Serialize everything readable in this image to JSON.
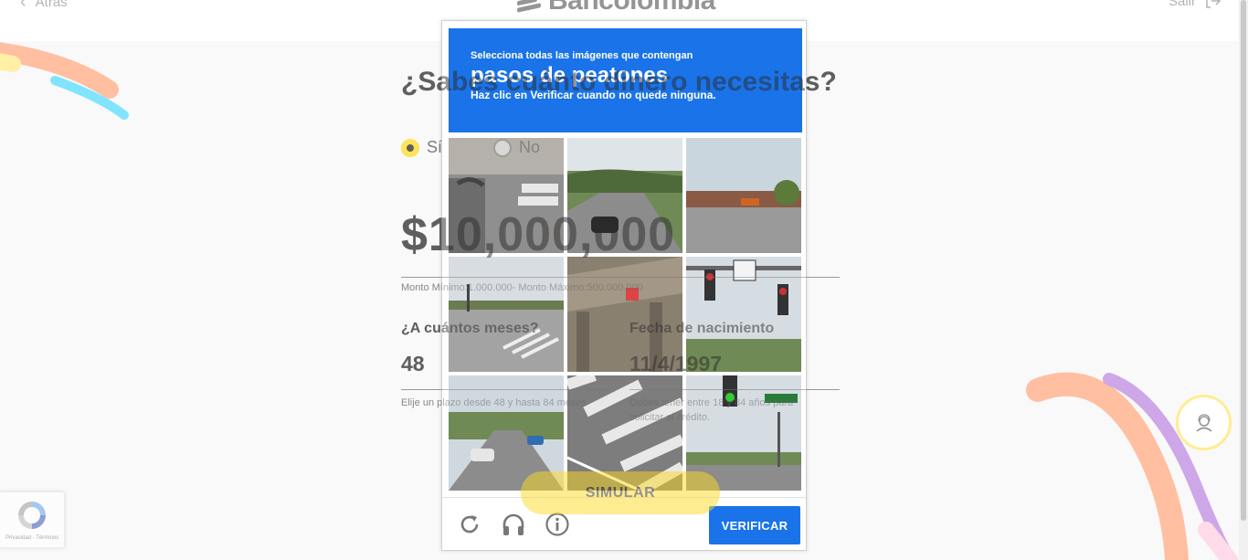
{
  "app": {
    "back_label": "Atrás",
    "brand": "Bancolombia",
    "exit_label": "Salir"
  },
  "form": {
    "question": "¿Sabes cuánto dinero necesitas?",
    "option_yes": "Sí",
    "option_no": "No",
    "selected": "Sí",
    "amount": "$10,000,000",
    "amount_hint": "Monto Mínimo:1.000.000- Monto Máximo:500.000.000",
    "months_label": "¿A cuántos meses?",
    "months_value": "48",
    "months_hint": "Elije un plazo desde 48 y hasta 84 meses",
    "birth_label": "Fecha de nacimiento",
    "birth_value": "11/4/1997",
    "birth_hint": "Debes tener entre 18 y 84 años para solicitar el crédito.",
    "submit_label": "SIMULAR"
  },
  "captcha": {
    "instruction_line1": "Selecciona todas las imágenes que contengan",
    "target": "pasos de peatones",
    "instruction_line3": "Haz clic en Verificar cuando no quede ninguna.",
    "verify_label": "VERIFICAR",
    "tiles": [
      {
        "scene": "crosswalk-street-corner"
      },
      {
        "scene": "road-with-car"
      },
      {
        "scene": "suburban-intersection"
      },
      {
        "scene": "intersection-traffic-light"
      },
      {
        "scene": "highway-overpass"
      },
      {
        "scene": "traffic-lights-signs"
      },
      {
        "scene": "street-with-cars"
      },
      {
        "scene": "crosswalk-closeup"
      },
      {
        "scene": "traffic-light-road"
      }
    ],
    "tools": [
      "reload-icon",
      "audio-icon",
      "info-icon"
    ]
  },
  "recaptcha_badge": {
    "legal": "Privacidad - Términos"
  },
  "colors": {
    "brand_yellow": "#fdda24",
    "captcha_blue": "#1a73e8",
    "deco_orange": "#ff7f41",
    "deco_cyan": "#00c8ff",
    "deco_purple": "#9c4fd1",
    "deco_pink": "#ffb4d2"
  }
}
